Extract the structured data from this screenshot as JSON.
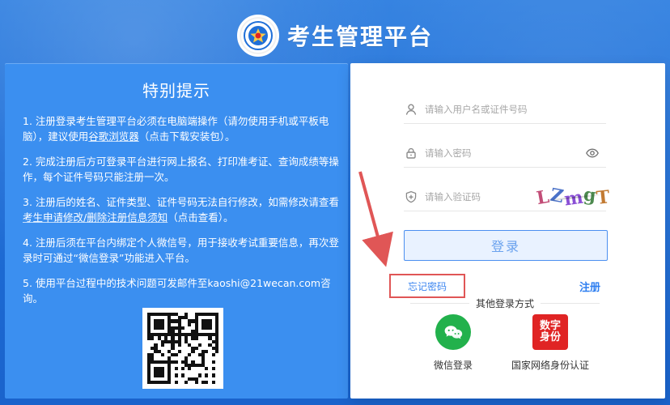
{
  "colors": {
    "brand_blue": "#1f6fd8",
    "panel_blue": "#3b8ff0",
    "login_border": "#4b8ff0",
    "forgot_border": "#e05656",
    "wechat_green": "#22b14c",
    "realid_red": "#e02424"
  },
  "header": {
    "title": "考生管理平台",
    "logo_icon": "emblem-icon"
  },
  "notice": {
    "title": "特别提示",
    "items": [
      {
        "pre": "1. 注册登录考生管理平台必须在电脑端操作（请勿使用手机或平板电脑），建议使用",
        "link": "谷歌浏览器",
        "post": "（点击下载安装包）。"
      },
      {
        "text": "2. 完成注册后方可登录平台进行网上报名、打印准考证、查询成绩等操作，每个证件号码只能注册一次。"
      },
      {
        "pre": "3. 注册后的姓名、证件类型、证件号码无法自行修改，如需修改请查看",
        "link": "考生申请修改/删除注册信息须知",
        "post": "（点击查看）。"
      },
      {
        "text": "4. 注册后须在平台内绑定个人微信号，用于接收考试重要信息，再次登录时可通过“微信登录”功能进入平台。"
      },
      {
        "text": "5. 使用平台过程中的技术问题可发邮件至kaoshi@21wecan.com咨询。"
      }
    ]
  },
  "login": {
    "username_placeholder": "请输入用户名或证件号码",
    "password_placeholder": "请输入密码",
    "captcha_placeholder": "请输入验证码",
    "captcha_chars": [
      "L",
      "Z",
      "m",
      "g",
      "T"
    ],
    "login_label": "登录",
    "forgot_label": "忘记密码",
    "register_label": "注册",
    "other_methods_label": "其他登录方式",
    "wechat_label": "微信登录",
    "realid_label": "国家网络身份认证",
    "realid_badge": [
      "数字",
      "身份"
    ],
    "icons": {
      "user": "user-icon",
      "lock": "lock-icon",
      "shield": "shield-icon",
      "eye": "eye-icon",
      "wechat": "wechat-icon",
      "realid": "digital-id-icon"
    }
  }
}
